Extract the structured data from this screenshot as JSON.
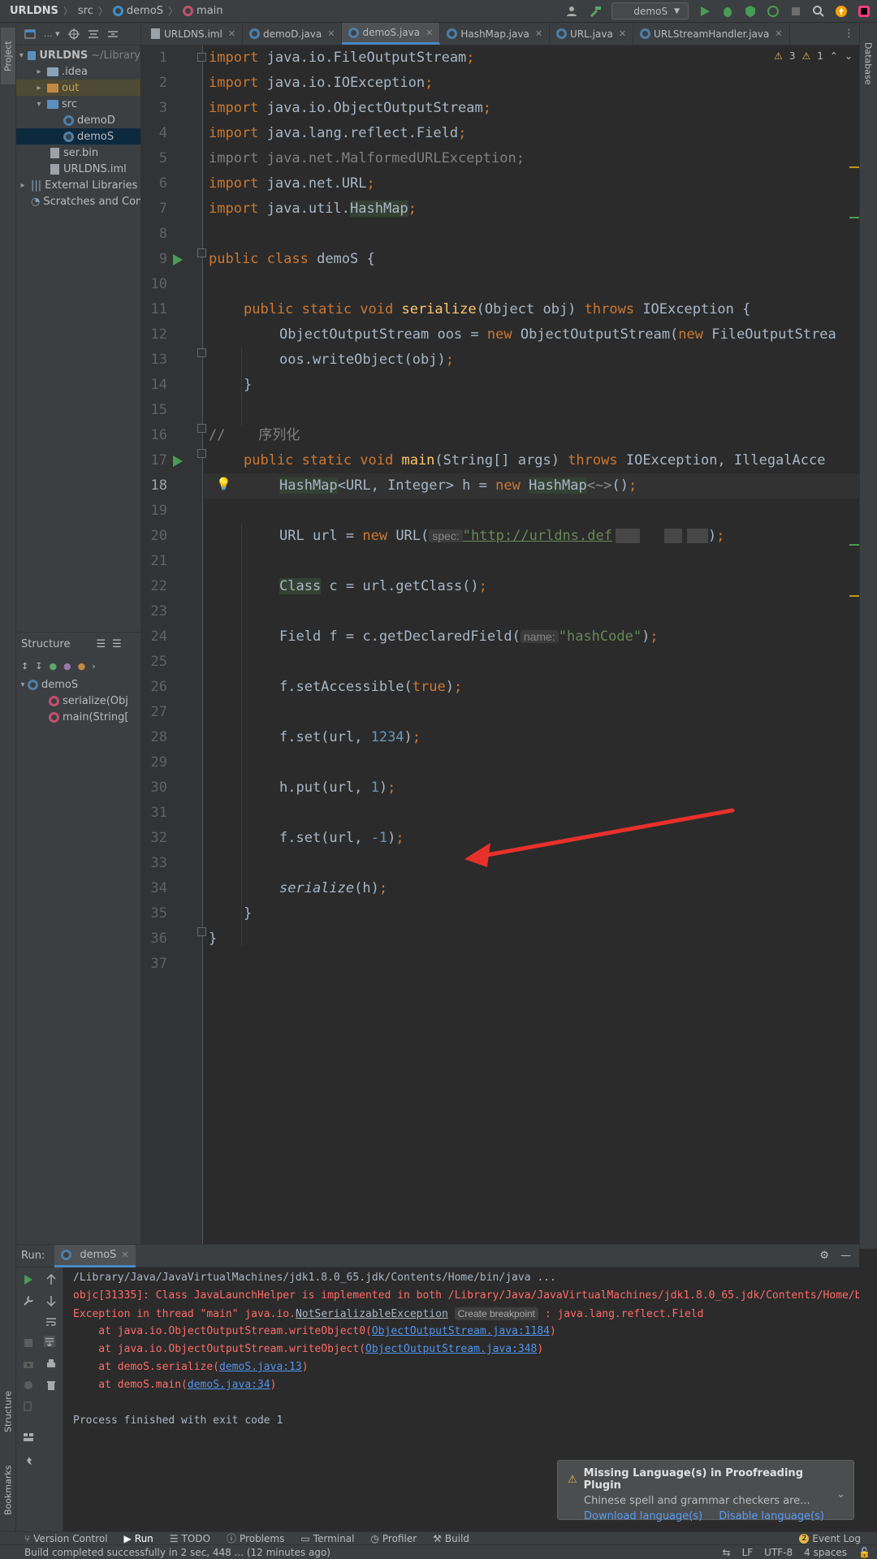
{
  "breadcrumb": {
    "project": "URLDNS",
    "folder": "src",
    "class": "demoS",
    "method": "main"
  },
  "toolbar": {
    "run_config": "demoS"
  },
  "left_strip": {
    "project_tab": "Project",
    "structure_tab": "Structure",
    "bookmarks_tab": "Bookmarks"
  },
  "right_strip": {
    "database_tab": "Database"
  },
  "project_tree": [
    {
      "label": "URLDNS",
      "suffix": "~/Library",
      "bold": true
    },
    {
      "label": ".idea"
    },
    {
      "label": "out"
    },
    {
      "label": "src"
    },
    {
      "label": "demoD"
    },
    {
      "label": "demoS"
    },
    {
      "label": "ser.bin"
    },
    {
      "label": "URLDNS.iml"
    },
    {
      "label": "External Libraries"
    },
    {
      "label": "Scratches and Con"
    }
  ],
  "structure": {
    "title": "Structure",
    "items": [
      {
        "label": "demoS"
      },
      {
        "label": "serialize(Obj"
      },
      {
        "label": "main(String["
      }
    ]
  },
  "tabs": [
    {
      "label": "URLDNS.iml"
    },
    {
      "label": "demoD.java"
    },
    {
      "label": "demoS.java"
    },
    {
      "label": "HashMap.java"
    },
    {
      "label": "URL.java"
    },
    {
      "label": "URLStreamHandler.java"
    }
  ],
  "editor": {
    "warnings": "3",
    "weak_warnings": "1",
    "line_numbers": [
      "1",
      "2",
      "3",
      "4",
      "5",
      "6",
      "7",
      "8",
      "9",
      "10",
      "11",
      "12",
      "13",
      "14",
      "15",
      "16",
      "17",
      "18",
      "19",
      "20",
      "21",
      "22",
      "23",
      "24",
      "25",
      "26",
      "27",
      "28",
      "29",
      "30",
      "31",
      "32",
      "33",
      "34",
      "35",
      "36",
      "37"
    ],
    "code": {
      "l1": {
        "kw": "import",
        "rest": " java.io.FileOutputStream",
        "semi": ";"
      },
      "l2": {
        "kw": "import",
        "rest": " java.io.IOException",
        "semi": ";"
      },
      "l3": {
        "kw": "import",
        "rest": " java.io.ObjectOutputStream",
        "semi": ";"
      },
      "l4": {
        "kw": "import",
        "rest": " java.lang.reflect.Field",
        "semi": ";"
      },
      "l5": {
        "text": "import java.net.MalformedURLException;"
      },
      "l6": {
        "kw": "import",
        "rest": " java.net.URL",
        "semi": ";"
      },
      "l7": {
        "kw": "import",
        "rest": " java.util.",
        "hl": "HashMap",
        "semi": ";"
      },
      "l9": {
        "kw1": "public",
        "kw2": " class",
        "rest": " demoS {"
      },
      "l11": {
        "kw": "public static void ",
        "fn": "serialize",
        "p1": "(Object obj) ",
        "kw2": "throws",
        "p2": " IOException {"
      },
      "l12": {
        "p1": "ObjectOutputStream oos = ",
        "kw": "new",
        "p2": " ObjectOutputStream(",
        "kw2": "new",
        "p3": " FileOutputStrea"
      },
      "l13": {
        "p1": "oos.writeObject(obj)",
        "semi": ";"
      },
      "l14": {
        "p1": "}"
      },
      "l16": {
        "text": "//    序列化"
      },
      "l17": {
        "kw": "public static void ",
        "fn": "main",
        "p1": "(String[] args) ",
        "kw2": "throws",
        "p2": " IOException, IllegalAcce"
      },
      "l18": {
        "hl1": "HashMap",
        "p1": "<URL, Integer> h = ",
        "kw": "new",
        "sp": " ",
        "hl2": "HashMap",
        "dim": "<~>",
        "p2": "()",
        "semi": ";"
      },
      "l20": {
        "p1": "URL url = ",
        "kw": "new",
        "p2": " URL(",
        "hint": "spec:",
        "str": "\"http://urldns.def",
        "p3": ")",
        "semi": ";"
      },
      "l22": {
        "hl": "Class",
        "p1": " c = url.getClass()",
        "semi": ";"
      },
      "l24": {
        "p1": "Field f = c.getDeclaredField(",
        "hint": "name:",
        "str": "\"hashCode\"",
        "p2": ")",
        "semi": ";"
      },
      "l26": {
        "p1": "f.setAccessible(",
        "kw": "true",
        "p2": ")",
        "semi": ";"
      },
      "l28": {
        "p1": "f.set(url, ",
        "num": "1234",
        "p2": ")",
        "semi": ";"
      },
      "l30": {
        "p1": "h.put(url, ",
        "num": "1",
        "p2": ")",
        "semi": ";"
      },
      "l32": {
        "p1": "f.set(url, ",
        "num": "-1",
        "p2": ")",
        "semi": ";"
      },
      "l34": {
        "it": "serialize",
        "p1": "(h)",
        "semi": ";"
      },
      "l35": {
        "p1": "}"
      },
      "l36": {
        "p1": "}"
      }
    }
  },
  "run": {
    "label": "Run:",
    "tab": "demoS",
    "console": {
      "l1": "/Library/Java/JavaVirtualMachines/jdk1.8.0_65.jdk/Contents/Home/bin/java ...",
      "l2": "objc[31335]: Class JavaLaunchHelper is implemented in both /Library/Java/JavaVirtualMachines/jdk1.8.0_65.jdk/Contents/Home/b",
      "l3a": "Exception in thread \"main\" java.io.",
      "l3b": "NotSerializableException",
      "l3chip": "Create breakpoint",
      "l3c": " : java.lang.reflect.Field",
      "l4a": "    at java.io.ObjectOutputStream.writeObject0(",
      "l4b": "ObjectOutputStream.java:1184",
      "l4c": ")",
      "l5a": "    at java.io.ObjectOutputStream.writeObject(",
      "l5b": "ObjectOutputStream.java:348",
      "l5c": ")",
      "l6a": "    at demoS.serialize(",
      "l6b": "demoS.java:13",
      "l6c": ")",
      "l7a": "    at demoS.main(",
      "l7b": "demoS.java:34",
      "l7c": ")",
      "l9": "Process finished with exit code 1"
    }
  },
  "notification": {
    "title": "Missing Language(s) in Proofreading Plugin",
    "body": "Chinese spell and grammar checkers are...",
    "action1": "Download language(s)",
    "action2": "Disable language(s)"
  },
  "bottom_tools": [
    {
      "label": "Version Control"
    },
    {
      "label": "Run"
    },
    {
      "label": "TODO"
    },
    {
      "label": "Problems"
    },
    {
      "label": "Terminal"
    },
    {
      "label": "Profiler"
    },
    {
      "label": "Build"
    }
  ],
  "event_log": {
    "count": "2",
    "label": "Event Log"
  },
  "status": {
    "message": "Build completed successfully in 2 sec, 448 ... (12 minutes ago)",
    "line_sep": "LF",
    "encoding": "UTF-8",
    "indent": "4 spaces"
  },
  "colors": {
    "accent": "#4a88c7",
    "keyword": "#cc7832",
    "string": "#6a8759",
    "number": "#6897bb",
    "error": "#ff6b68",
    "arrow": "#e8302b"
  }
}
